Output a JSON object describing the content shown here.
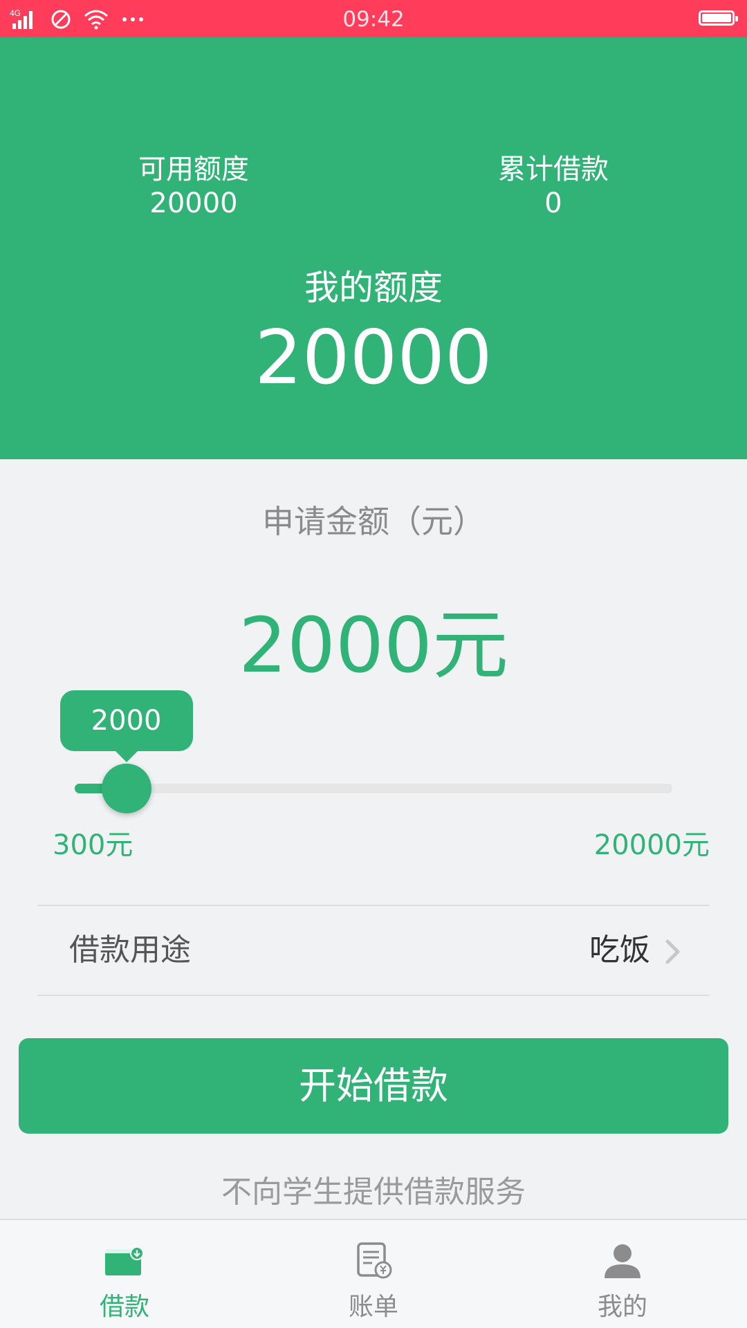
{
  "status_bar": {
    "network": "4G",
    "time": "09:42",
    "icons": [
      "signal-icon",
      "no-disturb-icon",
      "wifi-icon",
      "more-icon",
      "battery-icon"
    ]
  },
  "header": {
    "available_label": "可用额度",
    "available_value": "20000",
    "cumulative_label": "累计借款",
    "cumulative_value": "0",
    "quota_label": "我的额度",
    "quota_value": "20000"
  },
  "apply": {
    "label": "申请金额（元）",
    "amount_display": "2000元"
  },
  "slider": {
    "min": 300,
    "max": 20000,
    "value": 2000,
    "value_label": "2000",
    "min_label": "300元",
    "max_label": "20000元"
  },
  "purpose": {
    "label": "借款用途",
    "value": "吃饭"
  },
  "start_button": {
    "label": "开始借款"
  },
  "notice": "不向学生提供借款服务",
  "nav": {
    "items": [
      {
        "label": "借款",
        "icon": "wallet-icon",
        "active": true
      },
      {
        "label": "账单",
        "icon": "bill-icon",
        "active": false
      },
      {
        "label": "我的",
        "icon": "person-icon",
        "active": false
      }
    ]
  },
  "colors": {
    "status_bar": "#ff3c5a",
    "primary": "#31b378",
    "background": "#f1f2f4",
    "inactive": "#8c8c8c"
  }
}
